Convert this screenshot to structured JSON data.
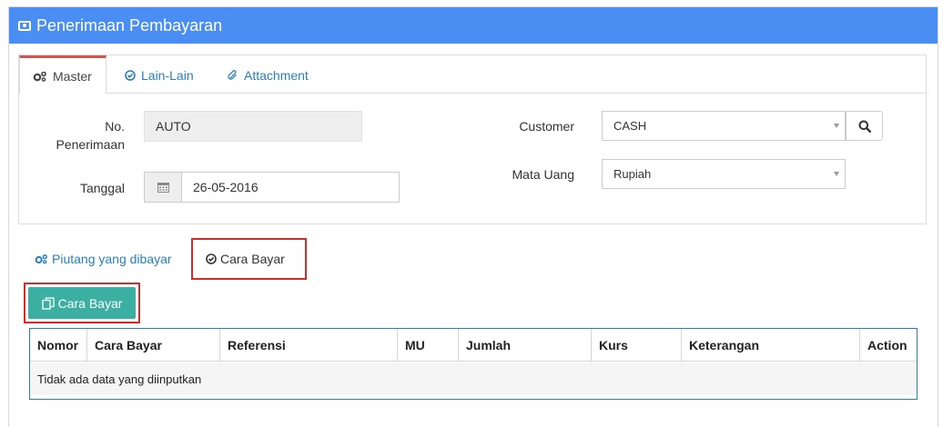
{
  "header": {
    "title": "Penerimaan Pembayaran",
    "icon": "money-icon"
  },
  "top_tabs": [
    {
      "label": "Master",
      "icon": "cogs-icon",
      "active": true
    },
    {
      "label": "Lain-Lain",
      "icon": "check-circle-icon",
      "active": false
    },
    {
      "label": "Attachment",
      "icon": "paperclip-icon",
      "active": false
    }
  ],
  "form": {
    "no_penerimaan_label_1": "No.",
    "no_penerimaan_label_2": "Penerimaan",
    "no_penerimaan_value": "AUTO",
    "tanggal_label": "Tanggal",
    "tanggal_value": "26-05-2016",
    "customer_label": "Customer",
    "customer_value": "CASH",
    "mata_uang_label": "Mata Uang",
    "mata_uang_value": "Rupiah"
  },
  "sub_tabs": [
    {
      "label": "Piutang yang dibayar",
      "icon": "cogs-icon",
      "active": false
    },
    {
      "label": "Cara Bayar",
      "icon": "check-circle-icon",
      "active": true
    }
  ],
  "add_button": {
    "label": "Cara Bayar",
    "icon": "copy-icon"
  },
  "table": {
    "columns": [
      "Nomor",
      "Cara Bayar",
      "Referensi",
      "MU",
      "Jumlah",
      "Kurs",
      "Keterangan",
      "Action"
    ],
    "empty_text": "Tidak ada data yang diinputkan"
  },
  "colors": {
    "header": "#4a8ef3",
    "accent_red": "#c9302c",
    "teal": "#3bafa1",
    "link": "#2a7fb8"
  }
}
